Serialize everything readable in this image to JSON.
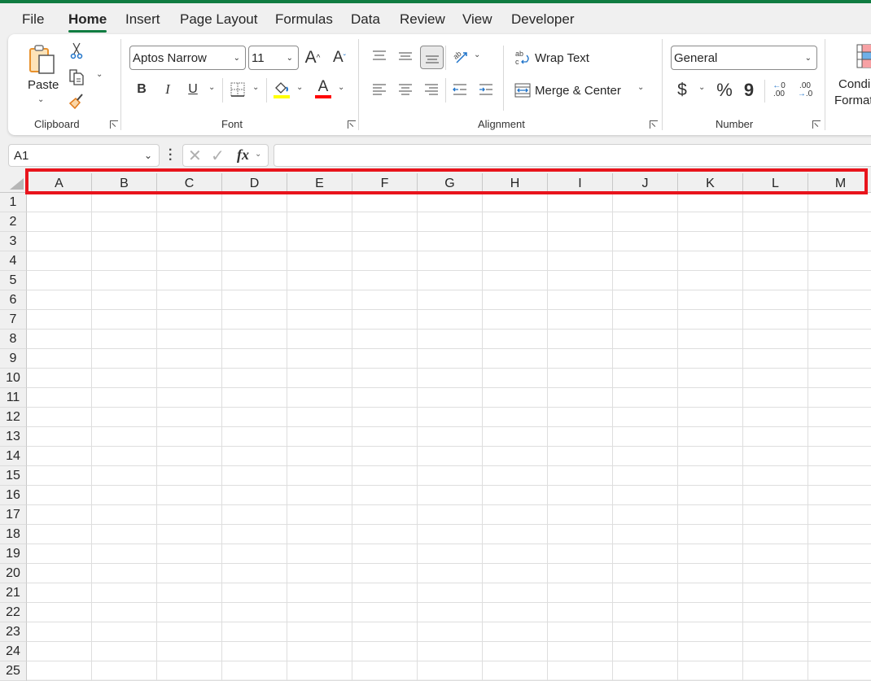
{
  "accent_color": "#107c41",
  "highlight_color": "#e8141c",
  "tabs": [
    {
      "label": "File",
      "active": false
    },
    {
      "label": "Home",
      "active": true
    },
    {
      "label": "Insert",
      "active": false
    },
    {
      "label": "Page Layout",
      "active": false
    },
    {
      "label": "Formulas",
      "active": false
    },
    {
      "label": "Data",
      "active": false
    },
    {
      "label": "Review",
      "active": false
    },
    {
      "label": "View",
      "active": false
    },
    {
      "label": "Developer",
      "active": false
    }
  ],
  "ribbon": {
    "clipboard": {
      "label": "Clipboard",
      "paste_label": "Paste",
      "icons": [
        "paste-icon",
        "cut-icon",
        "copy-icon",
        "format-painter-icon"
      ]
    },
    "font": {
      "label": "Font",
      "font_name": "Aptos Narrow",
      "font_size": "11",
      "bold": "B",
      "italic": "I",
      "underline": "U",
      "grow": "A",
      "shrink": "A",
      "font_color_letter": "A",
      "fill_color": "#ffff00",
      "font_color": "#ff0000"
    },
    "alignment": {
      "label": "Alignment",
      "wrap_text": "Wrap Text",
      "merge_center": "Merge & Center",
      "wrap_glyph": "ab"
    },
    "number": {
      "label": "Number",
      "format": "General",
      "currency": "$",
      "percent": "%",
      "comma": "9",
      "inc_decimal_top": "0",
      "inc_decimal_bottom": ".00",
      "dec_decimal_top": ".00",
      "dec_decimal_bottom": ".0"
    },
    "styles": {
      "conditional_line1": "Condi",
      "conditional_line2": "Format"
    }
  },
  "formula_bar": {
    "name_box": "A1",
    "fx_label": "fx",
    "formula": ""
  },
  "sheet": {
    "columns": [
      "A",
      "B",
      "C",
      "D",
      "E",
      "F",
      "G",
      "H",
      "I",
      "J",
      "K",
      "L",
      "M"
    ],
    "rows": [
      "1",
      "2",
      "3",
      "4",
      "5",
      "6",
      "7",
      "8",
      "9",
      "10",
      "11",
      "12",
      "13",
      "14",
      "15",
      "16",
      "17",
      "18",
      "19",
      "20",
      "21",
      "22",
      "23",
      "24",
      "25"
    ]
  }
}
